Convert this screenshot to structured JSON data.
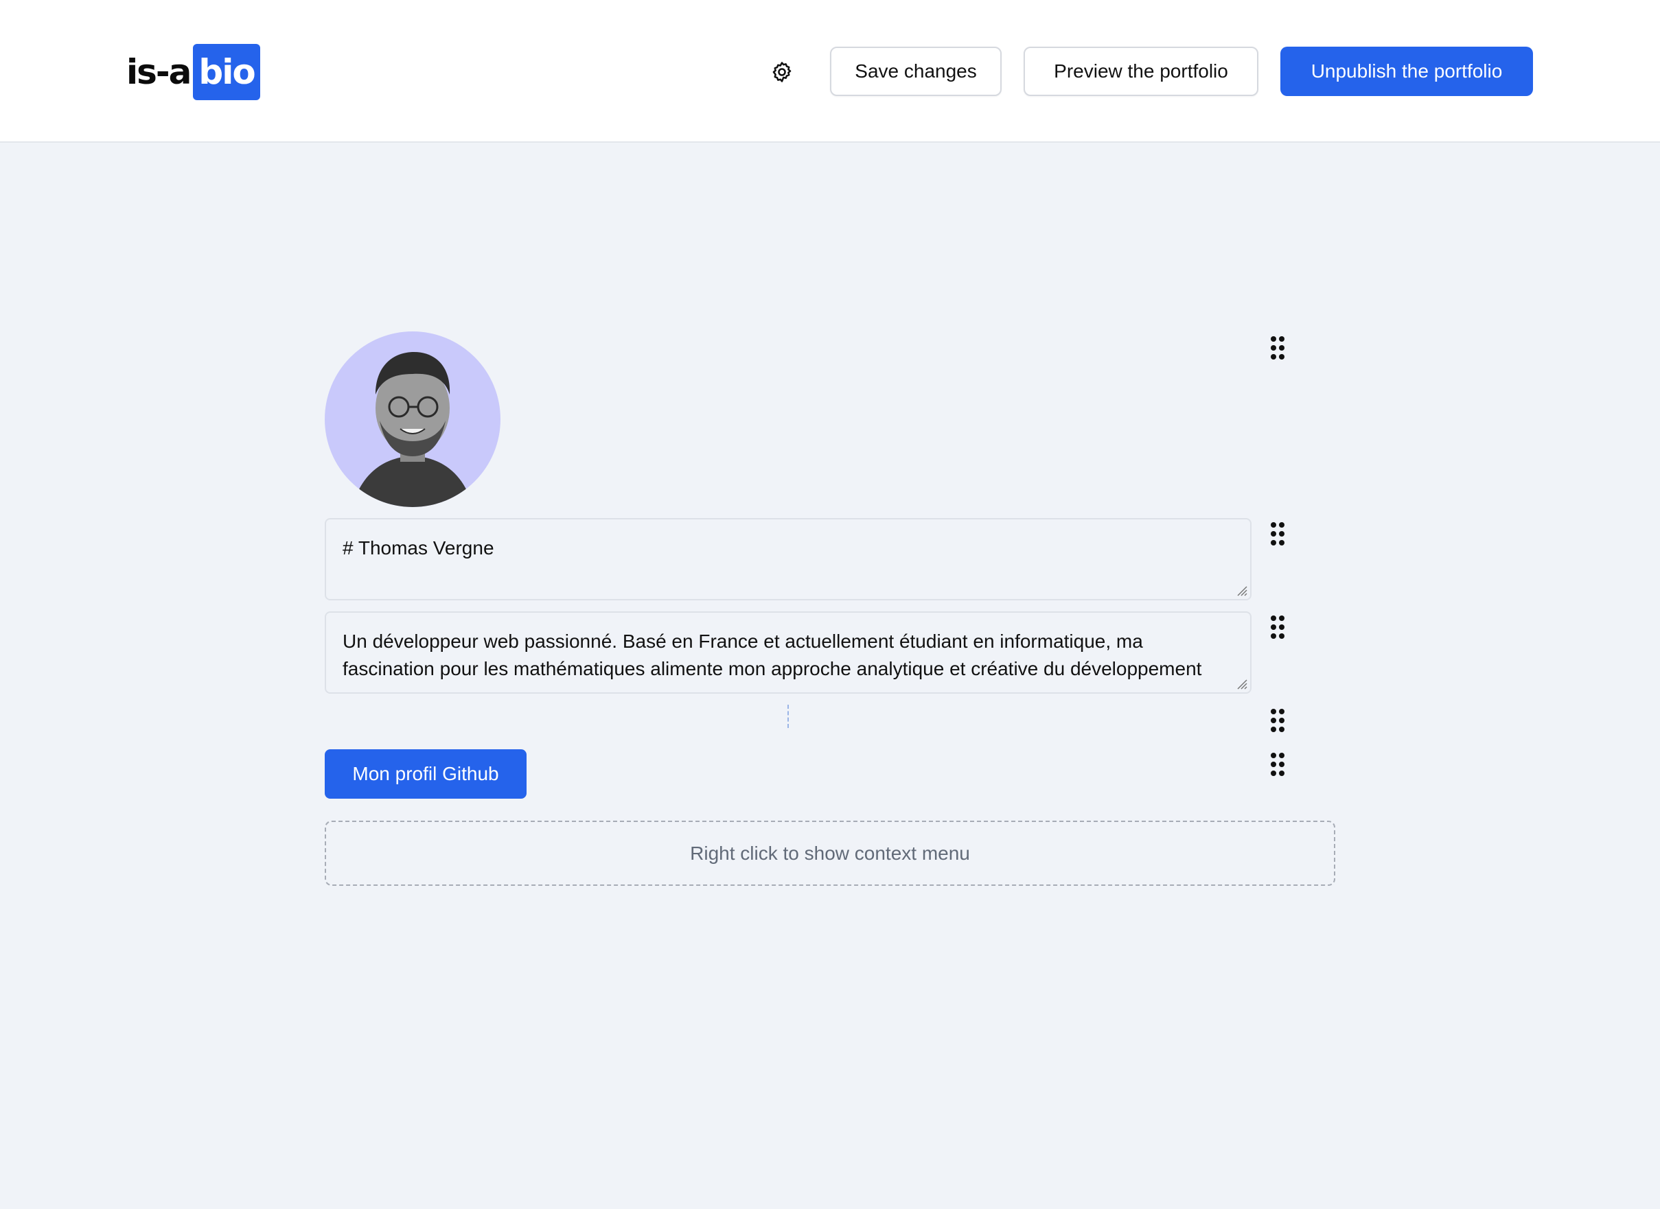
{
  "header": {
    "logo_prefix": "is-a",
    "logo_highlight": "bio",
    "settings_icon": "gear-icon",
    "save_label": "Save changes",
    "preview_label": "Preview the portfolio",
    "unpublish_label": "Unpublish the portfolio"
  },
  "editor": {
    "avatar_icon": "avatar",
    "title_value": "# Thomas Vergne",
    "bio_value": "Un développeur web passionné. Basé en France et actuellement étudiant en informatique, ma fascination pour les mathématiques alimente mon approche analytique et créative du développement",
    "button_label": "Mon profil Github",
    "dropzone_text": "Right click to show context menu"
  },
  "colors": {
    "accent": "#2563eb",
    "background": "#f0f3f8",
    "avatar_bg": "#c9c9fb"
  }
}
